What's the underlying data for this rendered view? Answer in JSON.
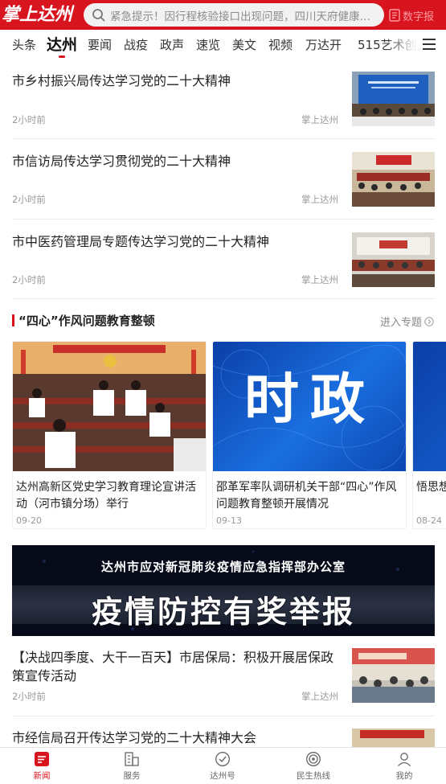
{
  "header": {
    "logo_text": "掌上达州",
    "search_placeholder": "紧急提示！因行程核验接口出现问题，四川天府健康通...",
    "digital_label": "数字报",
    "colors": {
      "brand_red": "#d8141f"
    }
  },
  "tabs": [
    {
      "label": "头条",
      "active": false
    },
    {
      "label": "达州",
      "active": true
    },
    {
      "label": "要闻",
      "active": false
    },
    {
      "label": "战疫",
      "active": false
    },
    {
      "label": "政声",
      "active": false
    },
    {
      "label": "速览",
      "active": false
    },
    {
      "label": "美文",
      "active": false
    },
    {
      "label": "视频",
      "active": false
    },
    {
      "label": "万达开",
      "active": false
    },
    {
      "label": "515艺术创",
      "active": false
    }
  ],
  "news_top": [
    {
      "title": "市乡村振兴局传达学习党的二十大精神",
      "time": "2小时前",
      "source": "掌上达州"
    },
    {
      "title": "市信访局传达学习贯彻党的二十大精神",
      "time": "2小时前",
      "source": "掌上达州"
    },
    {
      "title": "市中医药管理局专题传达学习党的二十大精神",
      "time": "2小时前",
      "source": "掌上达州"
    }
  ],
  "topic": {
    "title": "“四心”作风问题教育整顿",
    "more_label": "进入专题",
    "cards": [
      {
        "title": "达州高新区党史学习教育理论宣讲活动（河市镇分场）举行",
        "date": "09-20",
        "image_text": ""
      },
      {
        "title": "邵革军率队调研机关干部“四心”作风问题教育整顿开展情况",
        "date": "09-13",
        "image_text": "时政"
      },
      {
        "title": "悟思想…军巡考…",
        "date": "08-24",
        "image_text": ""
      }
    ]
  },
  "banner": {
    "top_text": "达州市应对新冠肺炎疫情应急指挥部办公室",
    "main_text": "疫情防控有奖举报"
  },
  "news_bottom": [
    {
      "title": "【决战四季度、大干一百天】市居保局：积极开展居保政策宣传活动",
      "time": "2小时前",
      "source": "掌上达州"
    },
    {
      "title": "市经信局召开传达学习党的二十大精神大会",
      "time": "",
      "source": ""
    }
  ],
  "bottom_nav": [
    {
      "label": "新闻",
      "icon": "news-icon",
      "active": true
    },
    {
      "label": "服务",
      "icon": "service-icon",
      "active": false
    },
    {
      "label": "达州号",
      "icon": "check-circle-icon",
      "active": false
    },
    {
      "label": "民生热线",
      "icon": "hotline-icon",
      "active": false
    },
    {
      "label": "我的",
      "icon": "user-icon",
      "active": false
    }
  ]
}
